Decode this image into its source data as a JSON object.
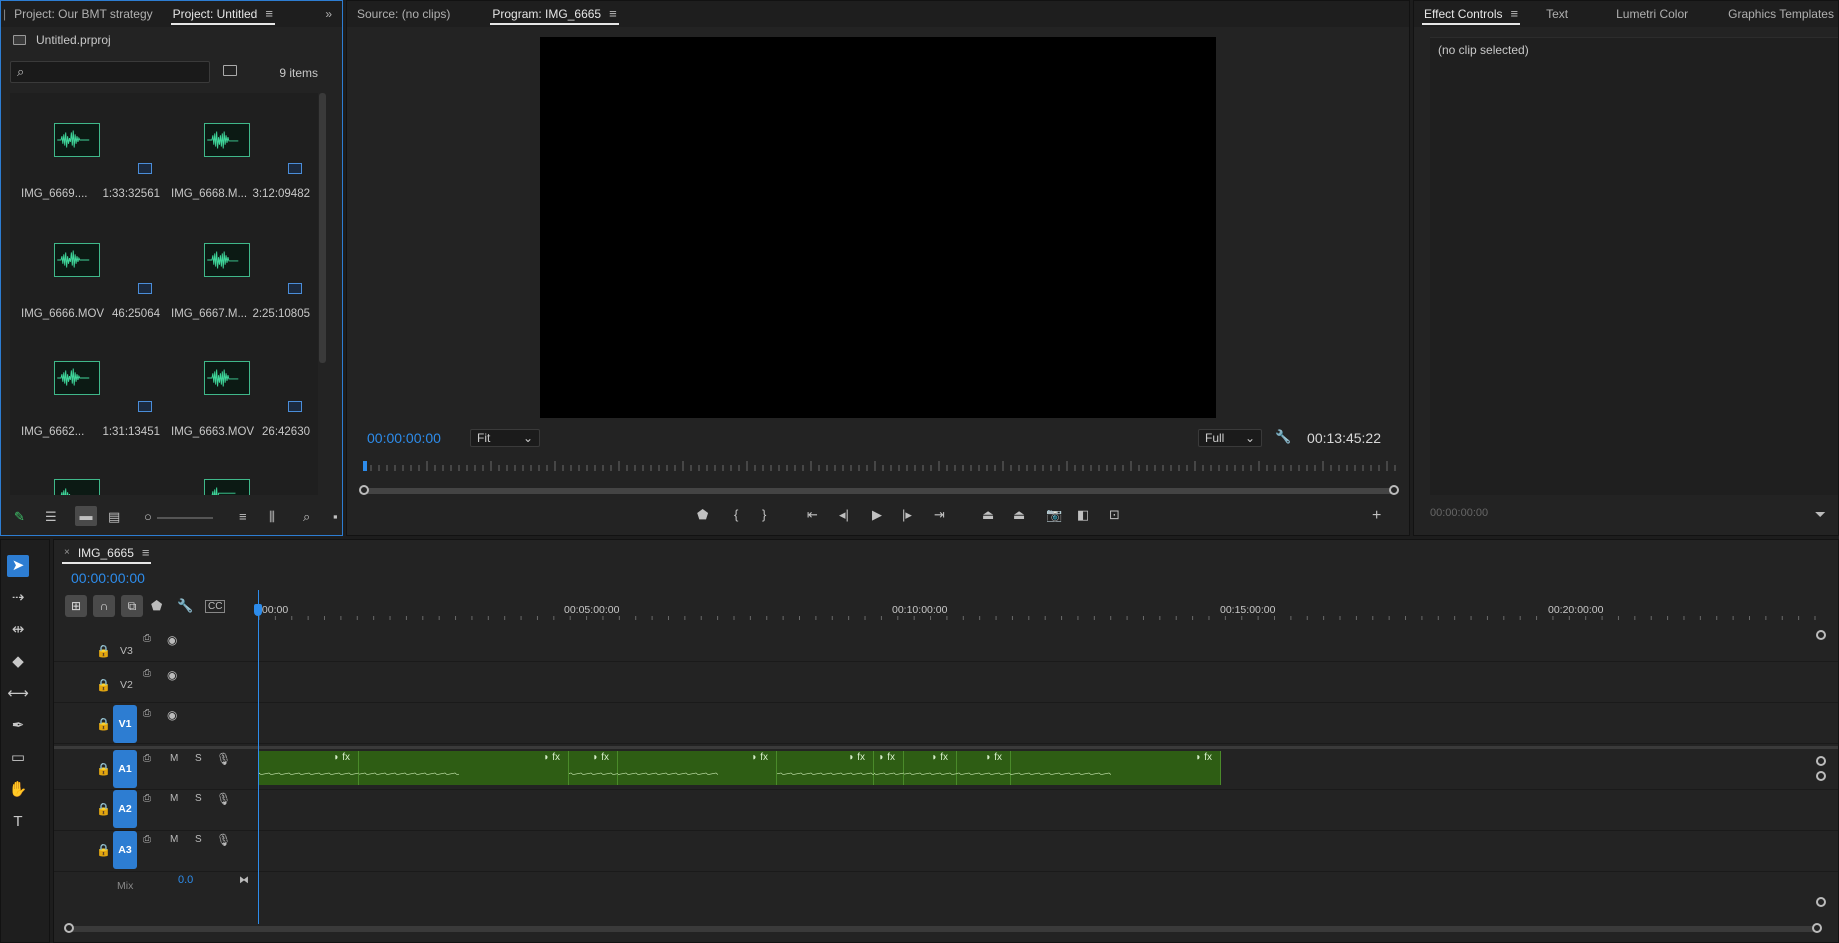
{
  "project": {
    "tabs": [
      "Project: Our BMT strategy",
      "Project: Untitled"
    ],
    "active_tab": "Project: Untitled",
    "file": "Untitled.prproj",
    "search_placeholder": "",
    "items_count": "9 items",
    "items": [
      {
        "name": "IMG_6669....",
        "duration": "1:33:32561"
      },
      {
        "name": "IMG_6668.M...",
        "duration": "3:12:09482"
      },
      {
        "name": "IMG_6666.MOV",
        "duration": "46:25064"
      },
      {
        "name": "IMG_6667.M...",
        "duration": "2:25:10805"
      },
      {
        "name": "IMG_6662...",
        "duration": "1:31:13451"
      },
      {
        "name": "IMG_6663.MOV",
        "duration": "26:42630"
      }
    ]
  },
  "program": {
    "tabs": [
      "Source: (no clips)",
      "Program: IMG_6665"
    ],
    "active_tab": "Program: IMG_6665",
    "timecode": "00:00:00:00",
    "fit": "Fit",
    "quality": "Full",
    "duration": "00:13:45:22"
  },
  "effects": {
    "tabs": [
      "Effect Controls",
      "Text",
      "Lumetri Color",
      "Graphics Templates"
    ],
    "active_tab": "Effect Controls",
    "no_clip": "(no clip selected)",
    "timecode": "00:00:00:00"
  },
  "timeline": {
    "sequence": "IMG_6665",
    "timecode": "00:00:00:00",
    "ruler_labels": [
      ":00:00",
      "00:05:00:00",
      "00:10:00:00",
      "00:15:00:00",
      "00:20:00:00"
    ],
    "video_tracks": [
      "V3",
      "V2",
      "V1"
    ],
    "audio_tracks": [
      "A1",
      "A2",
      "A3"
    ],
    "mix_label": "Mix",
    "mix_value": "0.0",
    "track_buttons": {
      "mute": "M",
      "solo": "S"
    }
  },
  "colors": {
    "accent": "#2d8ceb",
    "clip": "#2e5d14",
    "waveform": "#3fd69a"
  }
}
